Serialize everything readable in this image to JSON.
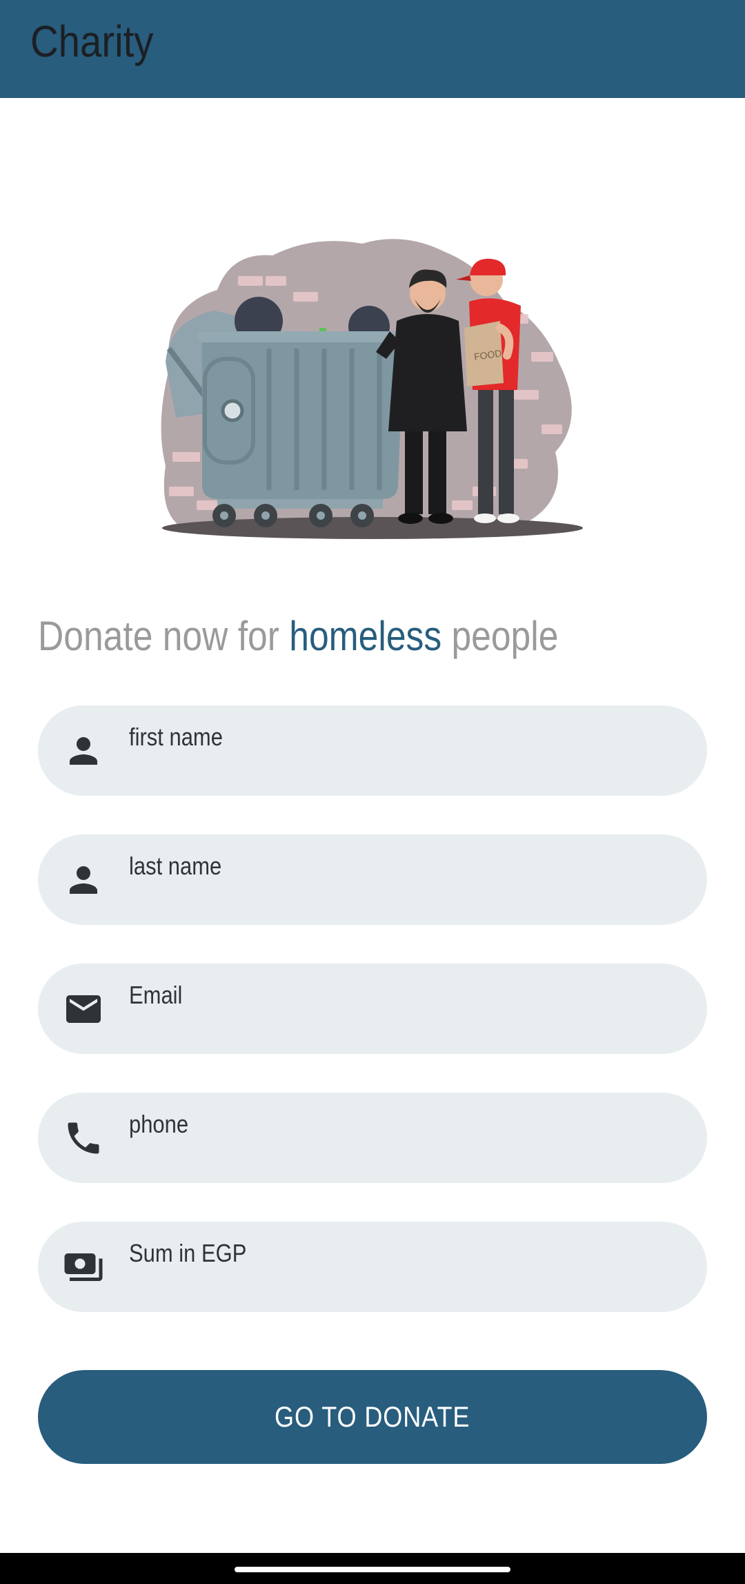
{
  "app": {
    "title": "Charity",
    "accent_color": "#285d7d"
  },
  "illustration": {
    "icon": "homeless-charity-illustration",
    "bag_text": "FOOD"
  },
  "headline": {
    "part1": "Donate now for ",
    "accent": "homeless",
    "part2": " people"
  },
  "form": {
    "fields": [
      {
        "placeholder": "first name",
        "icon": "person-icon"
      },
      {
        "placeholder": "last name",
        "icon": "person-icon"
      },
      {
        "placeholder": "Email",
        "icon": "mail-icon"
      },
      {
        "placeholder": "phone",
        "icon": "phone-icon"
      },
      {
        "placeholder": "Sum in EGP",
        "icon": "money-icon"
      }
    ],
    "submit_label": "GO TO DONATE"
  }
}
